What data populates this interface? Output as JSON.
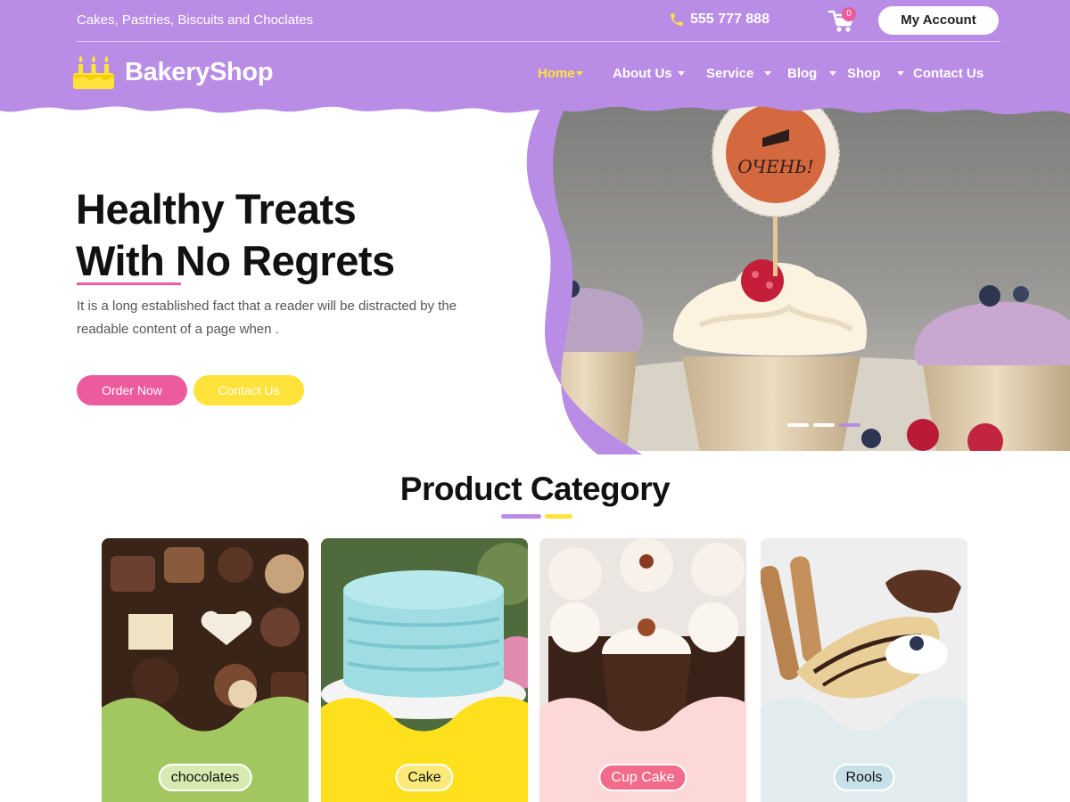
{
  "topbar": {
    "tagline": "Cakes, Pastries, Biscuits and Choclates",
    "phone": "555 777 888",
    "cart_count": "0",
    "account_label": "My Account"
  },
  "brand": {
    "name": "BakeryShop"
  },
  "nav": {
    "items": [
      {
        "label": "Home",
        "active": true,
        "dropdown": true
      },
      {
        "label": "About Us",
        "active": false,
        "dropdown": true
      },
      {
        "label": "Service",
        "active": false,
        "dropdown": true
      },
      {
        "label": "Blog",
        "active": false,
        "dropdown": true
      },
      {
        "label": "Shop",
        "active": false,
        "dropdown": true
      },
      {
        "label": "Contact Us",
        "active": false,
        "dropdown": false
      }
    ]
  },
  "hero": {
    "title_line1": "Healthy Treats",
    "title_line2": "With No Regrets",
    "description": "It is a long established fact that a reader will be distracted by the readable content of a page when .",
    "order_label": "Order Now",
    "contact_label": "Contact Us",
    "topper_text": "ОЧЕНЬ!",
    "slides_total": 3,
    "active_slide": 3
  },
  "categories": {
    "title": "Product Category",
    "items": [
      {
        "label": "chocolates",
        "panel_color": "#a3c760",
        "pill_color": "#d7ebb0"
      },
      {
        "label": "Cake",
        "panel_color": "#ffe01c",
        "pill_color": "#fbe97a"
      },
      {
        "label": "Cup Cake",
        "panel_color": "#fcd8d8",
        "pill_color": "#f26b8a"
      },
      {
        "label": "Rools",
        "panel_color": "#e2ecef",
        "pill_color": "#c8e0e8"
      }
    ]
  },
  "colors": {
    "purple": "#b98ce6",
    "pink": "#ec5b9d",
    "yellow": "#ffe23a"
  },
  "icons": [
    "phone-icon",
    "cart-icon",
    "cake-logo-icon",
    "chevron-down-icon"
  ]
}
